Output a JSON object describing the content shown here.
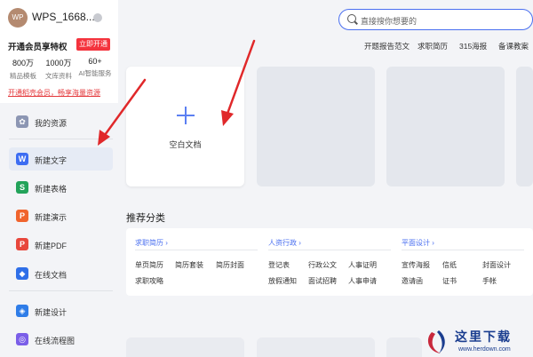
{
  "user": {
    "avatar_text": "WP",
    "name": "WPS_1668...",
    "vip_title": "开通会员享特权",
    "vip_button": "立即开通",
    "stats": [
      {
        "value": "800万",
        "label": "精品模板"
      },
      {
        "value": "1000万",
        "label": "文库资料"
      },
      {
        "value": "60+",
        "label": "AI智能服务"
      }
    ],
    "promo": "开通稻壳会员，畅享海量资源"
  },
  "nav": [
    {
      "label": "我的资源",
      "icon": "resource-icon",
      "color": "#8c96b3"
    },
    {
      "label": "新建文字",
      "icon": "word-icon",
      "color": "#3d6df2",
      "glyph": "W"
    },
    {
      "label": "新建表格",
      "icon": "sheet-icon",
      "color": "#23a35a",
      "glyph": "S"
    },
    {
      "label": "新建演示",
      "icon": "presentation-icon",
      "color": "#f0642d",
      "glyph": "P"
    },
    {
      "label": "新建PDF",
      "icon": "pdf-icon",
      "color": "#e8473c",
      "glyph": "P"
    },
    {
      "label": "在线文档",
      "icon": "online-doc-icon",
      "color": "#2f6fe8",
      "glyph": "◆"
    },
    {
      "label": "新建设计",
      "icon": "design-icon",
      "color": "#2f7de8",
      "glyph": "◈"
    },
    {
      "label": "在线流程图",
      "icon": "flowchart-icon",
      "color": "#7a5ee8",
      "glyph": "◎"
    }
  ],
  "search": {
    "placeholder": "直接搜你想要的"
  },
  "hot_links": [
    "开题报告范文",
    "求职简历",
    "315海报",
    "备课教案"
  ],
  "blank_card": {
    "label": "空白文档"
  },
  "section_title": "推荐分类",
  "categories": [
    {
      "head": "求职简历 ›",
      "items": [
        "单页简历",
        "简历套装",
        "简历封面",
        "求职攻略"
      ]
    },
    {
      "head": "人资行政 ›",
      "items": [
        "登记表",
        "行政公文",
        "人事证明",
        "放假通知",
        "面试招聘",
        "人事申请"
      ]
    },
    {
      "head": "平面设计 ›",
      "items": [
        "宣传海报",
        "信纸",
        "封面设计",
        "邀请函",
        "证书",
        "手帐"
      ]
    }
  ],
  "watermark": {
    "title": "这里下载",
    "url": "www.herdown.com"
  },
  "colors": {
    "accent": "#4a6ff0",
    "vip_red": "#f4333d",
    "arrow_red": "#e0282a"
  }
}
